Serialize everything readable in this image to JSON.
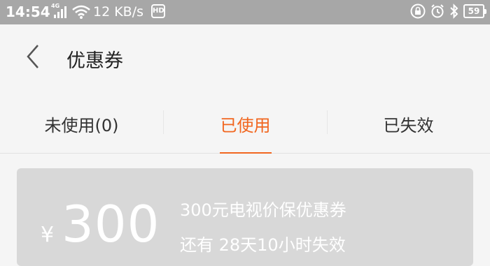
{
  "status_bar": {
    "time": "14:54",
    "network_type": "4G",
    "speed": "12 KB/s",
    "hd_badge": "HD",
    "battery": "59",
    "icons": [
      "signal-icon",
      "wifi-icon",
      "lock-icon",
      "alarm-icon",
      "bluetooth-icon",
      "battery-icon"
    ]
  },
  "header": {
    "title": "优惠券"
  },
  "tabs": [
    {
      "label": "未使用(0)",
      "active": false
    },
    {
      "label": "已使用",
      "active": true
    },
    {
      "label": "已失效",
      "active": false
    }
  ],
  "coupon": {
    "currency": "¥",
    "amount": "300",
    "name": "300元电视价保优惠券",
    "expire_text": "还有 28天10小时失效"
  },
  "colors": {
    "accent": "#f1661f",
    "status_bar": "#a7a7a7",
    "coupon_bg": "#d8d8d8",
    "background": "#f5f5f5"
  }
}
